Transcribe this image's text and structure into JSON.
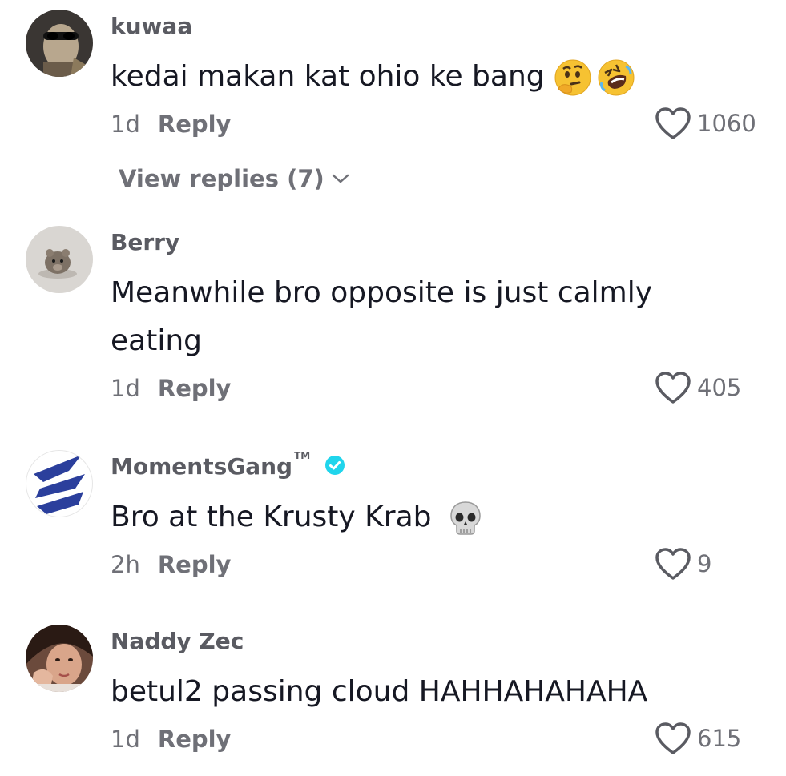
{
  "comments": [
    {
      "username": "kuwaa",
      "text": "kedai makan kat ohio ke bang",
      "emojis": [
        "thinking-face",
        "rolling-on-floor-laughing"
      ],
      "time": "1d",
      "reply_label": "Reply",
      "likes": "1060",
      "view_replies": "View replies (7)"
    },
    {
      "username": "Berry",
      "text": "Meanwhile bro opposite is just calmly eating",
      "time": "1d",
      "reply_label": "Reply",
      "likes": "405"
    },
    {
      "username": "MomentsGang",
      "username_suffix": "TM",
      "verified": true,
      "text": "Bro at the Krusty Krab",
      "emojis": [
        "skull"
      ],
      "time": "2h",
      "reply_label": "Reply",
      "likes": "9"
    },
    {
      "username": "Naddy Zec",
      "text": "betul2 passing cloud HAHHAHAHAHA",
      "time": "1d",
      "reply_label": "Reply",
      "likes": "615"
    }
  ],
  "colors": {
    "username": "#5a5b62",
    "text": "#161823",
    "meta": "#6f7077",
    "verified": "#20d5ec"
  }
}
